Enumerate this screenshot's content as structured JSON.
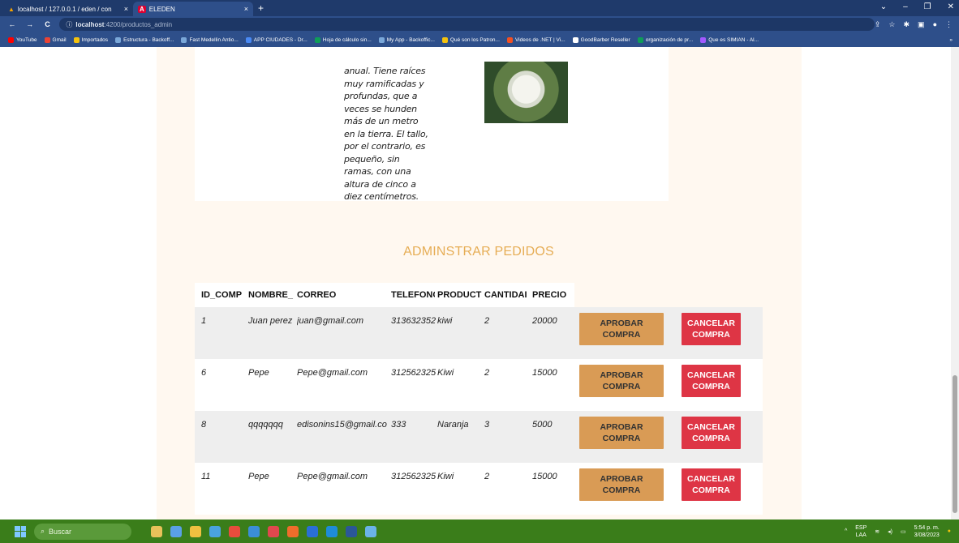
{
  "browser": {
    "tabs": [
      {
        "label": "localhost / 127.0.0.1 / eden / con",
        "close": "×"
      },
      {
        "label": "ELEDEN",
        "close": "×"
      }
    ],
    "new_tab": "+",
    "window_controls": [
      "⌄",
      "–",
      "❐",
      "✕"
    ],
    "nav": {
      "back": "←",
      "forward": "→",
      "reload": "C"
    },
    "url_host": "localhost",
    "url_path": ":4200/productos_admin",
    "bookmarks": [
      {
        "label": "YouTube",
        "color": "#ff0000"
      },
      {
        "label": "Gmail",
        "color": "#ea4335"
      },
      {
        "label": "Importados",
        "color": "#f4c20d"
      },
      {
        "label": "Estructura - Backoff...",
        "color": "#7aa7d8"
      },
      {
        "label": "Fast Medellin Antio...",
        "color": "#7aa7d8"
      },
      {
        "label": "APP CIUDADES - Dr...",
        "color": "#4a8af4"
      },
      {
        "label": "Hoja de cálculo sin...",
        "color": "#0f9d58"
      },
      {
        "label": "My App - Backoffic...",
        "color": "#7aa7d8"
      },
      {
        "label": "Qué son los Patron...",
        "color": "#f4c20d"
      },
      {
        "label": "Videos de .NET | Vi...",
        "color": "#f25022"
      },
      {
        "label": "GoodBarber Reseller",
        "color": "#ffffff"
      },
      {
        "label": "organización de pr...",
        "color": "#0f9d58"
      },
      {
        "label": "Que es SIMIAN - Al...",
        "color": "#a259ff"
      }
    ]
  },
  "product": {
    "description": "anual. Tiene raíces muy ramificadas y profundas, que a veces se hunden más de un metro en la tierra. El tallo, por el contrario, es pequeño, sin ramas, con una altura de cinco a diez centímetros."
  },
  "orders": {
    "title": "ADMINSTRAR PEDIDOS",
    "columns": [
      "ID_COMP",
      "NOMBRE_",
      "CORREO",
      "TELEFONC",
      "PRODUCT",
      "CANTIDAI",
      "PRECIO"
    ],
    "rows": [
      {
        "id": "1",
        "nombre": "Juan perez",
        "correo": "juan@gmail.com",
        "telefono": "313632352",
        "producto": "kiwi",
        "cantidad": "2",
        "precio": "20000"
      },
      {
        "id": "6",
        "nombre": "Pepe",
        "correo": "Pepe@gmail.com",
        "telefono": "312562325",
        "producto": "Kiwi",
        "cantidad": "2",
        "precio": "15000"
      },
      {
        "id": "8",
        "nombre": "qqqqqqq",
        "correo": "edisonins15@gmail.co",
        "telefono": "333",
        "producto": "Naranja",
        "cantidad": "3",
        "precio": "5000"
      },
      {
        "id": "11",
        "nombre": "Pepe",
        "correo": "Pepe@gmail.com",
        "telefono": "312562325",
        "producto": "Kiwi",
        "cantidad": "2",
        "precio": "15000"
      }
    ],
    "approve_label": "APROBAR COMPRA",
    "cancel_label": "CANCELAR COMPRA"
  },
  "taskbar": {
    "search": "Buscar",
    "lang": "ESP",
    "lang_sub": "LAA",
    "time": "5:54 p. m.",
    "date": "3/08/2023"
  }
}
